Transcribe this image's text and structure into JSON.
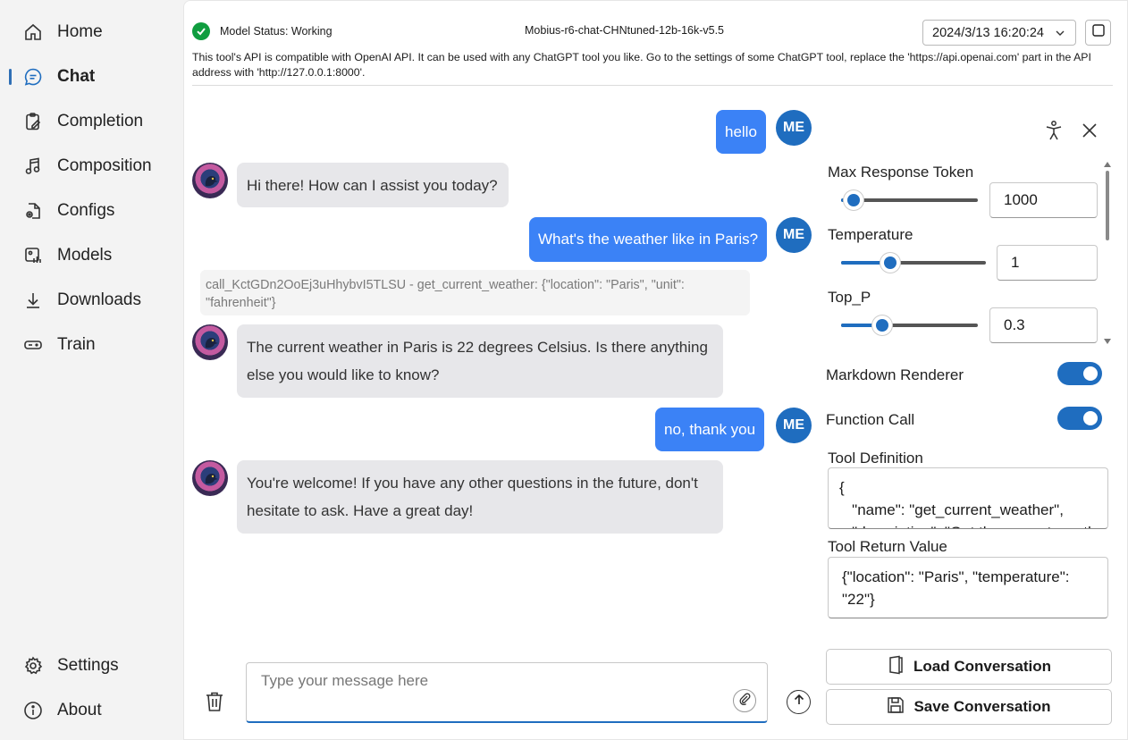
{
  "sidebar": {
    "items": [
      {
        "label": "Home",
        "icon": "home-icon"
      },
      {
        "label": "Chat",
        "icon": "chat-icon",
        "active": true
      },
      {
        "label": "Completion",
        "icon": "clipboard-edit-icon"
      },
      {
        "label": "Composition",
        "icon": "music-note-icon"
      },
      {
        "label": "Configs",
        "icon": "config-document-icon"
      },
      {
        "label": "Models",
        "icon": "models-icon"
      },
      {
        "label": "Downloads",
        "icon": "download-icon"
      },
      {
        "label": "Train",
        "icon": "train-icon"
      }
    ],
    "bottom": [
      {
        "label": "Settings",
        "icon": "gear-icon"
      },
      {
        "label": "About",
        "icon": "info-icon"
      }
    ]
  },
  "header": {
    "status_text": "Model Status: Working",
    "model_name": "Mobius-r6-chat-CHNtuned-12b-16k-v5.5",
    "datetime": "2024/3/13 16:20:24",
    "notice": "This tool's API is compatible with OpenAI API. It can be used with any ChatGPT tool you like. Go to the settings of some ChatGPT tool, replace the 'https://api.openai.com' part in the API address with 'http://127.0.0.1:8000'."
  },
  "chat": {
    "me_label": "ME",
    "messages": [
      {
        "role": "user",
        "text": "hello"
      },
      {
        "role": "bot",
        "text": "Hi there! How can I assist you today?"
      },
      {
        "role": "user",
        "text": "What's the weather like in Paris?"
      },
      {
        "role": "call",
        "text": "call_KctGDn2OoEj3uHhybvI5TLSU - get_current_weather: {\"location\": \"Paris\", \"unit\": \"fahrenheit\"}"
      },
      {
        "role": "bot",
        "text": "The current weather in Paris is 22 degrees Celsius. Is there anything else you would like to know?"
      },
      {
        "role": "user",
        "text": "no, thank you"
      },
      {
        "role": "bot",
        "text": "You're welcome! If you have any other questions in the future, don't hesitate to ask. Have a great day!"
      }
    ],
    "input_placeholder": "Type your message here"
  },
  "panel": {
    "max_tokens": {
      "label": "Max Response Token",
      "value": "1000",
      "fraction": 0.09
    },
    "temperature": {
      "label": "Temperature",
      "value": "1",
      "fraction": 0.34
    },
    "top_p": {
      "label": "Top_P",
      "value": "0.3",
      "fraction": 0.3
    },
    "markdown": {
      "label": "Markdown Renderer",
      "on": true
    },
    "function_call": {
      "label": "Function Call",
      "on": true
    },
    "tool_definition": {
      "label": "Tool Definition",
      "text": "{\n   \"name\": \"get_current_weather\",\n   \"description\": \"Get the current weather"
    },
    "tool_return": {
      "label": "Tool Return Value",
      "text": "{\"location\": \"Paris\", \"temperature\": \"22\"}"
    },
    "load_label": "Load Conversation",
    "save_label": "Save Conversation"
  },
  "colors": {
    "accent": "#1f6dbf",
    "user_bubble": "#3b82f6",
    "bot_bubble": "#e7e7ea",
    "status_ok": "#0f9d3f"
  }
}
